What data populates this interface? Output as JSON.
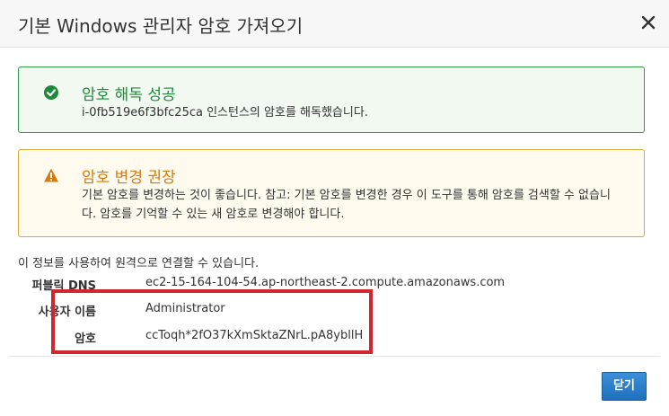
{
  "dialog": {
    "title": "기본 Windows 관리자 암호 가져오기",
    "close_icon": "close-icon"
  },
  "success": {
    "icon": "check-circle-icon",
    "title": "암호 해독 성공",
    "body": "i-0fb519e6f3bfc25ca 인스턴스의 암호를 해독했습니다."
  },
  "warning": {
    "icon": "warning-triangle-icon",
    "title": "암호 변경 권장",
    "body": "기본 암호를 변경하는 것이 좋습니다. 참고: 기본 암호를 변경한 경우 이 도구를 통해 암호를 검색할 수 없습니다. 암호를 기억할 수 있는 새 암호로 변경해야 합니다."
  },
  "connection": {
    "intro": "이 정보를 사용하여 원격으로 연결할 수 있습니다.",
    "dns_label": "퍼블릭 DNS",
    "dns_value": "ec2-15-164-104-54.ap-northeast-2.compute.amazonaws.com",
    "user_label": "사용자 이름",
    "user_value": "Administrator",
    "password_label": "암호",
    "password_value": "ccToqh*2fO37kXmSktaZNrL.pA8ybllH"
  },
  "footer": {
    "close_label": "닫기"
  },
  "colors": {
    "success": "#1d8a3a",
    "warning": "#d87a0a",
    "highlight": "#d0262e",
    "primary_button": "#1f6fbd"
  }
}
